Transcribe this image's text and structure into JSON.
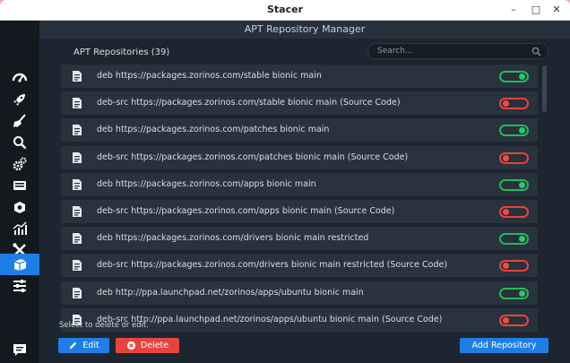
{
  "window": {
    "title": "Stacer",
    "controls": {
      "minimize": "–",
      "maximize": "□",
      "close": "✕"
    }
  },
  "header": {
    "title": "APT Repository Manager"
  },
  "sidebar": {
    "items": [
      {
        "icon": "dashboard-icon",
        "active": false
      },
      {
        "icon": "rocket-icon",
        "active": false
      },
      {
        "icon": "broom-icon",
        "active": false
      },
      {
        "icon": "search-icon",
        "active": false
      },
      {
        "icon": "gears-icon",
        "active": false
      },
      {
        "icon": "processes-icon",
        "active": false
      },
      {
        "icon": "uninstaller-icon",
        "active": false
      },
      {
        "icon": "resources-icon",
        "active": false
      },
      {
        "icon": "tools-icon",
        "active": false
      },
      {
        "icon": "apt-repository-icon",
        "active": true
      },
      {
        "icon": "settings-icon",
        "active": false
      },
      {
        "icon": "feedback-icon",
        "active": false
      }
    ]
  },
  "repositories": {
    "title": "APT Repositories (39)",
    "search_placeholder": "Search...",
    "items": [
      {
        "label": "deb https://packages.zorinos.com/stable bionic main",
        "enabled": true
      },
      {
        "label": "deb-src https://packages.zorinos.com/stable bionic main (Source Code)",
        "enabled": false
      },
      {
        "label": "deb https://packages.zorinos.com/patches bionic main",
        "enabled": true
      },
      {
        "label": "deb-src https://packages.zorinos.com/patches bionic main (Source Code)",
        "enabled": false
      },
      {
        "label": "deb https://packages.zorinos.com/apps bionic main",
        "enabled": true
      },
      {
        "label": "deb-src https://packages.zorinos.com/apps bionic main (Source Code)",
        "enabled": false
      },
      {
        "label": "deb https://packages.zorinos.com/drivers bionic main restricted",
        "enabled": true
      },
      {
        "label": "deb-src https://packages.zorinos.com/drivers bionic main restricted (Source Code)",
        "enabled": false
      },
      {
        "label": "deb http://ppa.launchpad.net/zorinos/apps/ubuntu bionic main",
        "enabled": true
      },
      {
        "label": "deb-src http://ppa.launchpad.net/zorinos/apps/ubuntu bionic main (Source Code)",
        "enabled": false
      }
    ]
  },
  "footer": {
    "hint": "Select to delete or edit.",
    "edit_label": "Edit",
    "delete_label": "Delete",
    "add_label": "Add Repository"
  },
  "colors": {
    "accent": "#1f7ee6",
    "danger": "#e8433f",
    "toggle_on": "#2fc866",
    "toggle_off": "#f04c47",
    "sidebar_bg": "#14191f",
    "main_bg": "#1d2630",
    "row_bg": "#29333e"
  }
}
